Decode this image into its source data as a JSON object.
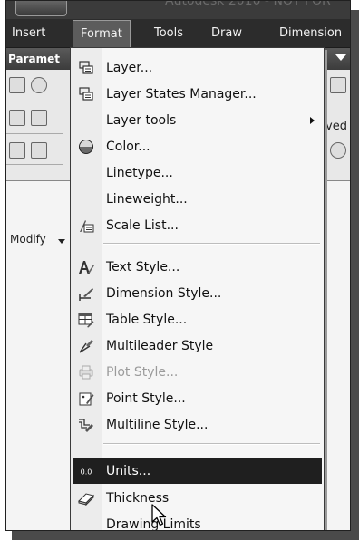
{
  "window": {
    "title_fragment": "Autodesk 2010 - NOT FOR"
  },
  "menubar": {
    "items": [
      {
        "label": "Insert"
      },
      {
        "label": "Format"
      },
      {
        "label": "Tools"
      },
      {
        "label": "Draw"
      },
      {
        "label": "Dimension"
      }
    ],
    "active": "Format"
  },
  "ribbon": {
    "tab_label": "Paramet",
    "panel_label": "Modify",
    "right_fragment": "ved"
  },
  "format_menu": {
    "items": [
      {
        "label": "Layer...",
        "icon": "layer-icon"
      },
      {
        "label": "Layer States Manager...",
        "icon": "layer-states-icon"
      },
      {
        "label": "Layer tools",
        "icon": "",
        "submenu": true
      },
      {
        "label": "Color...",
        "icon": "color-icon"
      },
      {
        "label": "Linetype...",
        "icon": ""
      },
      {
        "label": "Lineweight...",
        "icon": ""
      },
      {
        "label": "Scale List...",
        "icon": "scale-list-icon"
      },
      {
        "label": "Text Style...",
        "icon": "text-style-icon"
      },
      {
        "label": "Dimension Style...",
        "icon": "dimension-style-icon"
      },
      {
        "label": "Table Style...",
        "icon": "table-style-icon"
      },
      {
        "label": "Multileader Style",
        "icon": "multileader-style-icon"
      },
      {
        "label": "Plot Style...",
        "icon": "plot-style-icon",
        "disabled": true
      },
      {
        "label": "Point Style...",
        "icon": "point-style-icon"
      },
      {
        "label": "Multiline Style...",
        "icon": "multiline-style-icon"
      },
      {
        "label": "Units...",
        "icon": "units-icon",
        "highlighted": true,
        "icon_text": "0.0"
      },
      {
        "label": "Thickness",
        "icon": "thickness-icon"
      },
      {
        "label": "Drawing Limits",
        "icon": ""
      }
    ]
  },
  "colors": {
    "menubar_bg": "#2c2c2c",
    "highlight_bg": "#1f1f1f",
    "disabled_text": "#9b9b9b"
  }
}
